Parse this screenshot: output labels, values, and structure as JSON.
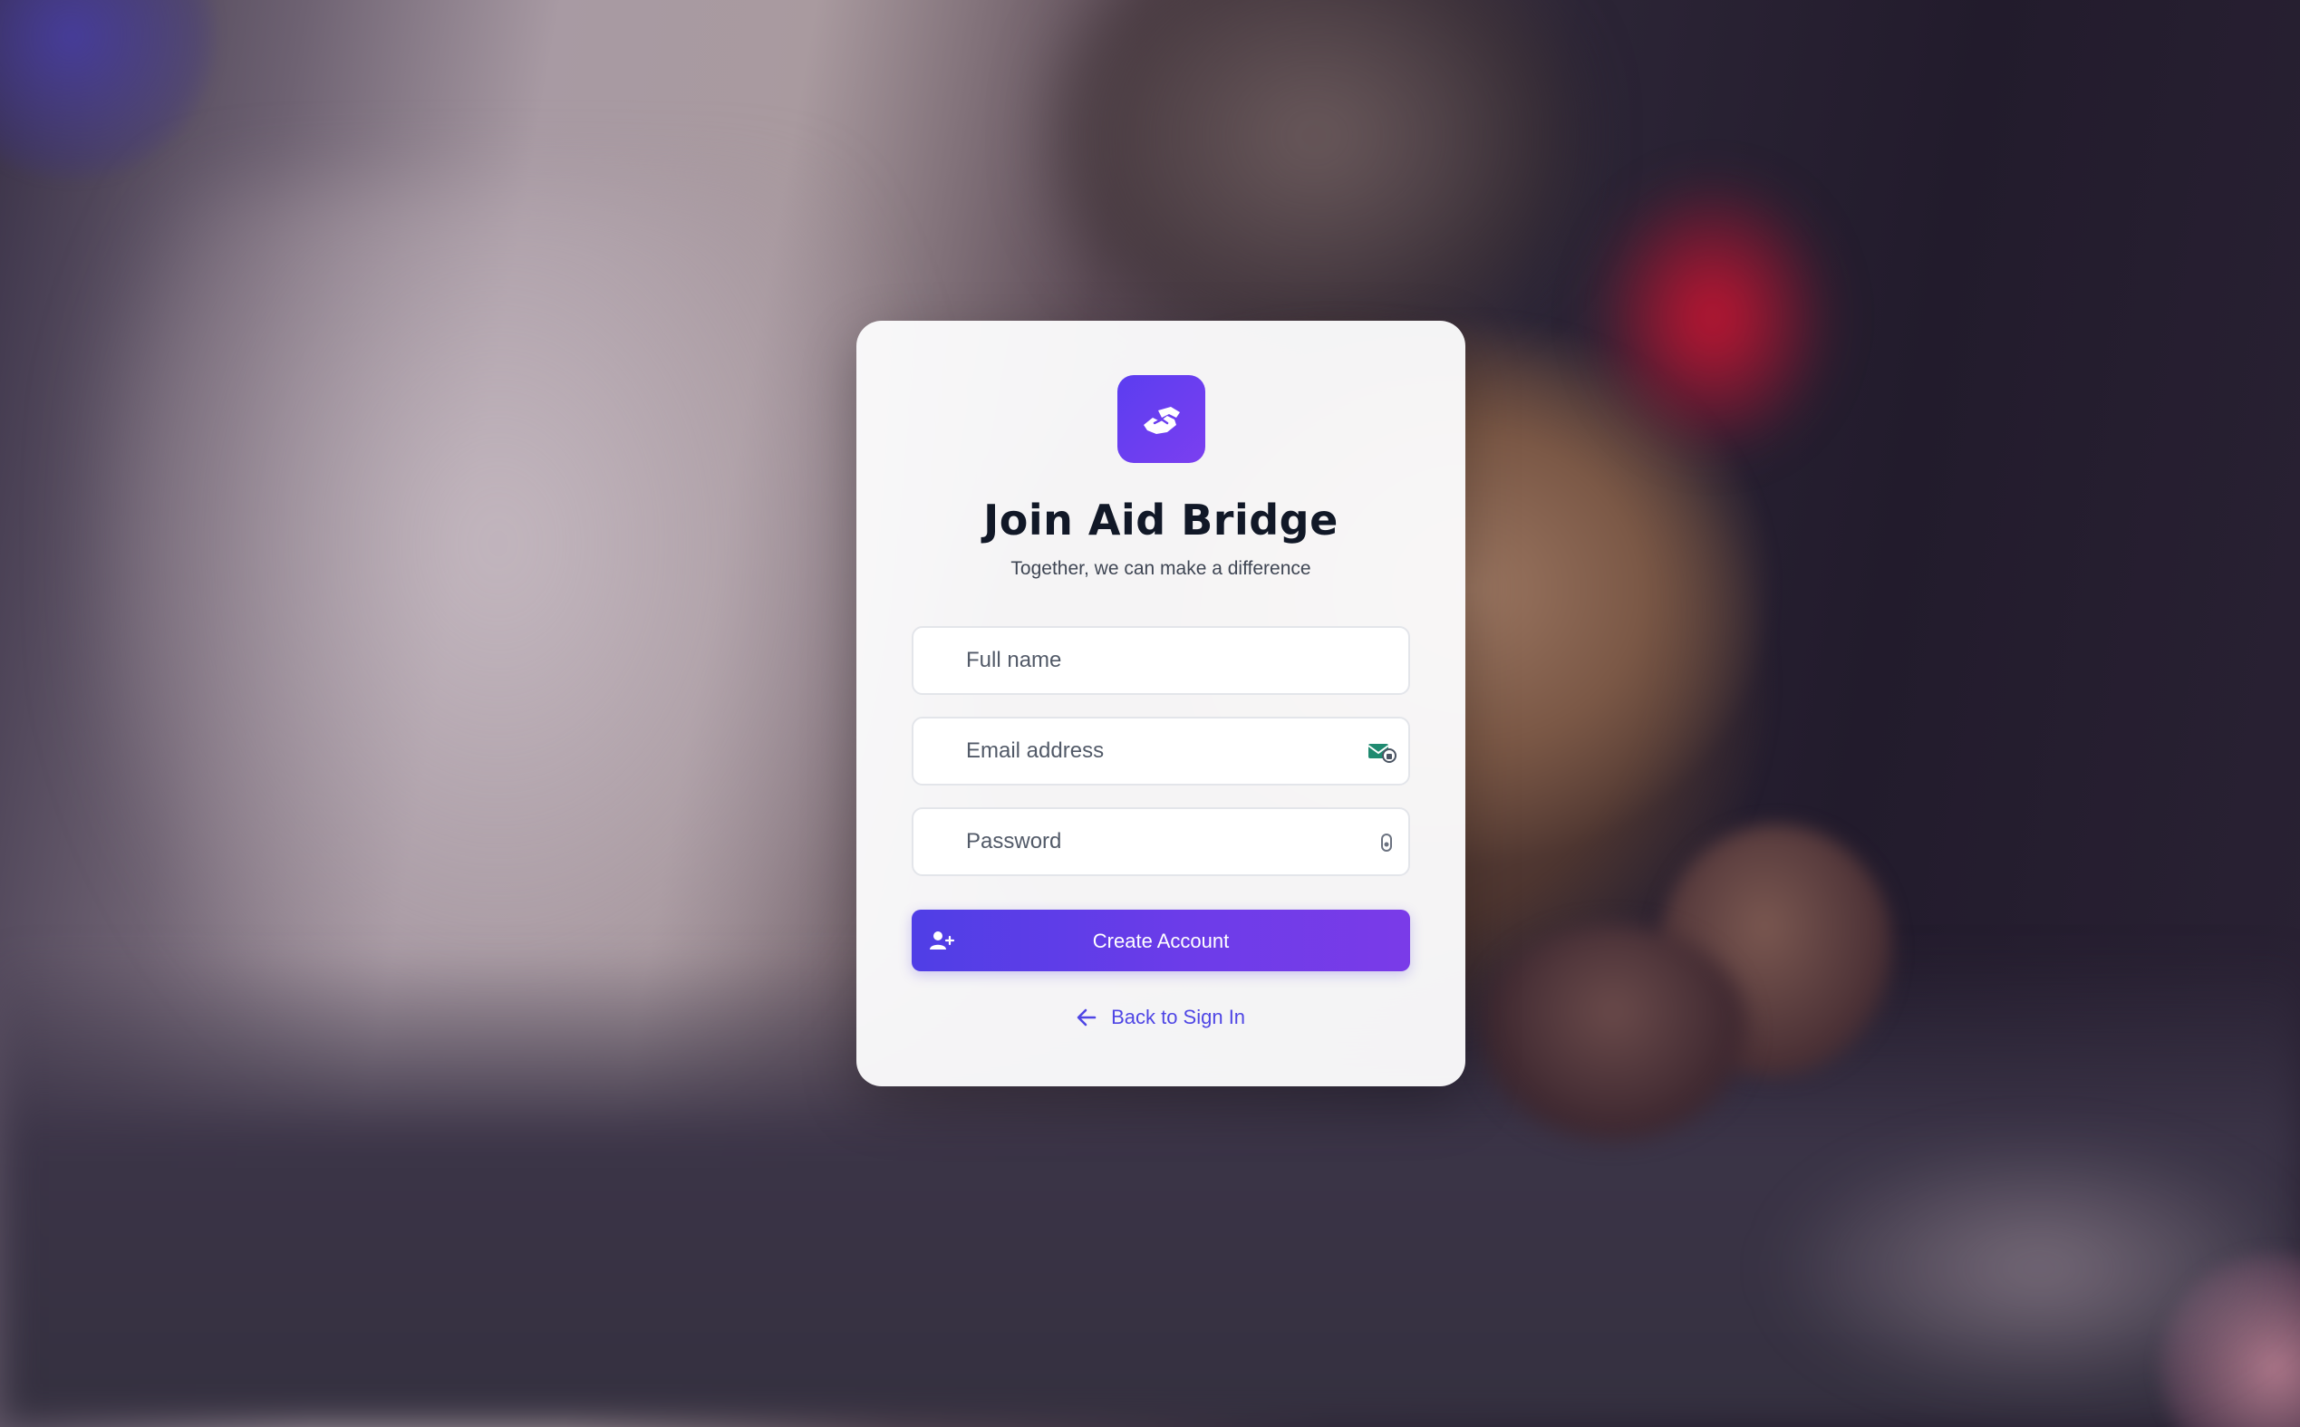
{
  "app": {
    "title": "Join Aid Bridge",
    "subtitle": "Together, we can make a difference",
    "logo_icon": "handshake-icon"
  },
  "form": {
    "full_name": {
      "value": "",
      "placeholder": "Full name"
    },
    "email": {
      "value": "",
      "placeholder": "Email address",
      "icon": "email-autofill-icon"
    },
    "password": {
      "value": "",
      "placeholder": "Password",
      "icon": "password-key-icon"
    }
  },
  "actions": {
    "create_account_label": "Create Account",
    "create_account_icon": "user-plus-icon",
    "back_to_sign_in_label": "Back to Sign In",
    "back_icon": "arrow-left-icon"
  },
  "colors": {
    "accent_start": "#4f3ee6",
    "accent_end": "#7a3be8",
    "link": "#4f46e5",
    "title": "#111827"
  }
}
